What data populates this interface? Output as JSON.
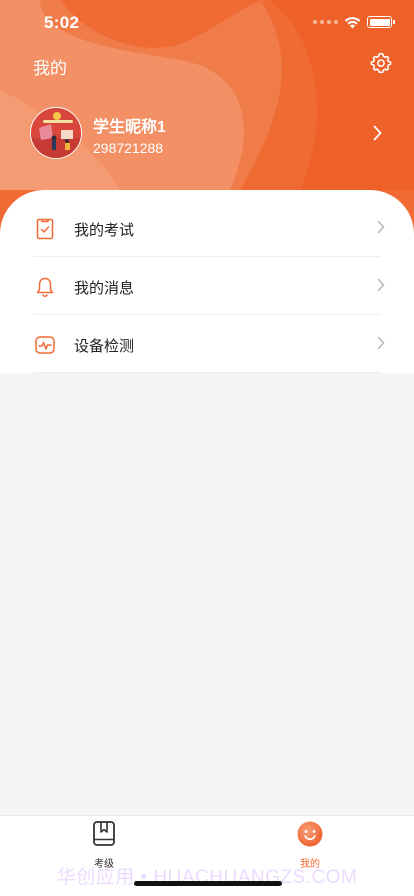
{
  "status_bar": {
    "time": "5:02"
  },
  "header": {
    "title": "我的",
    "settings_icon": "gear-icon",
    "colors": {
      "primary": "#f06a34",
      "light": "#f5a07a",
      "mid": "#f28a5a"
    }
  },
  "profile": {
    "nickname": "学生昵称1",
    "user_id": "298721288"
  },
  "menu": {
    "items": [
      {
        "label": "我的考试",
        "icon": "exam-clipboard-icon"
      },
      {
        "label": "我的消息",
        "icon": "bell-icon"
      },
      {
        "label": "设备检测",
        "icon": "device-check-icon"
      }
    ]
  },
  "tab_bar": {
    "tabs": [
      {
        "label": "考级",
        "icon": "book-icon",
        "active": false
      },
      {
        "label": "我的",
        "icon": "smiley-face-icon",
        "active": true
      }
    ]
  },
  "watermark": "华创应用 • HUACHUANGZS.COM"
}
